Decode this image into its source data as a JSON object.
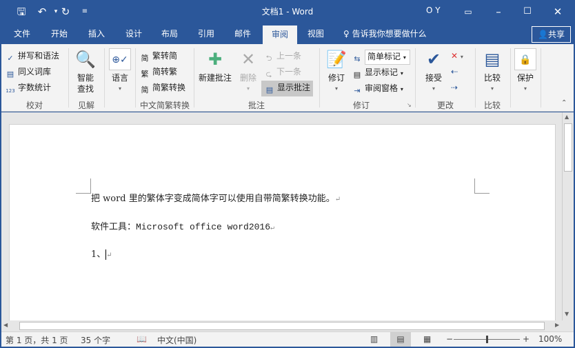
{
  "window": {
    "title": "文档1 - Word",
    "user": "O Y"
  },
  "qat": {
    "save": "save-icon",
    "undo": "undo-icon",
    "redo": "redo-icon",
    "customize": "customize-icon"
  },
  "tabs": [
    "文件",
    "开始",
    "插入",
    "设计",
    "布局",
    "引用",
    "邮件",
    "审阅",
    "视图"
  ],
  "active_tab": "审阅",
  "tell_me": "告诉我你想要做什么",
  "share": "共享",
  "ribbon": {
    "proofing": {
      "items": [
        "拼写和语法",
        "同义词库",
        "字数统计"
      ],
      "label": "校对"
    },
    "insights": {
      "button": [
        "智能",
        "查找"
      ],
      "label": "见解"
    },
    "language": {
      "button": "语言",
      "label": ""
    },
    "chinese": {
      "items": [
        "繁转简",
        "简转繁",
        "简繁转换"
      ],
      "label": "中文简繁转换"
    },
    "comments": {
      "new": "新建批注",
      "delete": "删除",
      "prev": "上一条",
      "next": "下一条",
      "show": "显示批注",
      "label": "批注"
    },
    "tracking": {
      "track": "修订",
      "markup_select": "简单标记",
      "show_markup": "显示标记",
      "review_pane": "审阅窗格",
      "label": "修订"
    },
    "changes": {
      "accept": "接受",
      "label": "更改"
    },
    "compare": {
      "button": "比较",
      "label": "比较"
    },
    "protect": {
      "button": "保护"
    }
  },
  "document": {
    "lines": [
      "把 word 里的繁体字变成简体字可以使用自带简繁转换功能。",
      "软件工具：Microsoft office word2016",
      "1、"
    ],
    "para_mark": "↵"
  },
  "status": {
    "page": "第 1 页，共 1 页",
    "words": "35 个字",
    "language": "中文(中国)",
    "zoom": "100%",
    "zoom_percent": 100
  },
  "colors": {
    "brand": "#2b579a"
  }
}
